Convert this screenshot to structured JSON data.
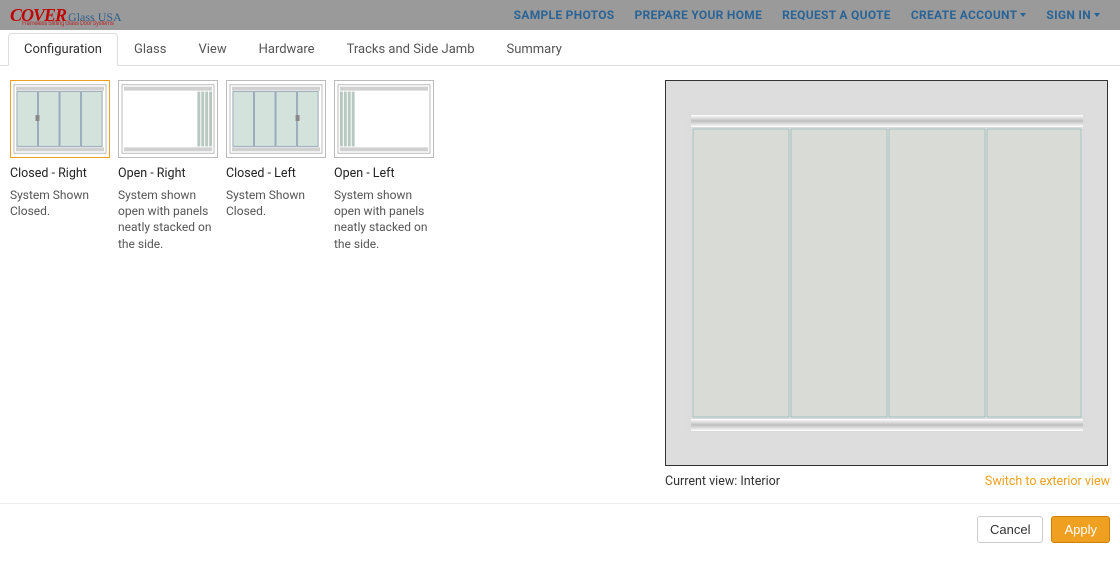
{
  "brand": {
    "cover": "COVER",
    "glass": "Glass USA",
    "tagline": "Frameless Sliding Glass Door Systems"
  },
  "nav": {
    "sample_photos": "SAMPLE PHOTOS",
    "prepare_home": "PREPARE YOUR HOME",
    "request_quote": "REQUEST A QUOTE",
    "create_account": "CREATE ACCOUNT",
    "sign_in": "SIGN IN"
  },
  "tabs": {
    "configuration": "Configuration",
    "glass": "Glass",
    "view": "View",
    "hardware": "Hardware",
    "tracks": "Tracks and Side Jamb",
    "summary": "Summary"
  },
  "options": [
    {
      "title": "Closed - Right",
      "desc": "System Shown Closed."
    },
    {
      "title": "Open - Right",
      "desc": "System shown open with panels neatly stacked on the side."
    },
    {
      "title": "Closed - Left",
      "desc": "System Shown Closed."
    },
    {
      "title": "Open - Left",
      "desc": "System shown open with panels neatly stacked on the side."
    }
  ],
  "preview": {
    "current_view": "Current view: Interior",
    "switch_view": "Switch to exterior view"
  },
  "footer": {
    "cancel": "Cancel",
    "apply": "Apply"
  },
  "colors": {
    "accent_orange": "#f0a020",
    "brand_red": "#c00000",
    "brand_blue": "#2a6496",
    "panel_glass": "#d3e2db",
    "frame_grey": "#c9c9c9"
  }
}
